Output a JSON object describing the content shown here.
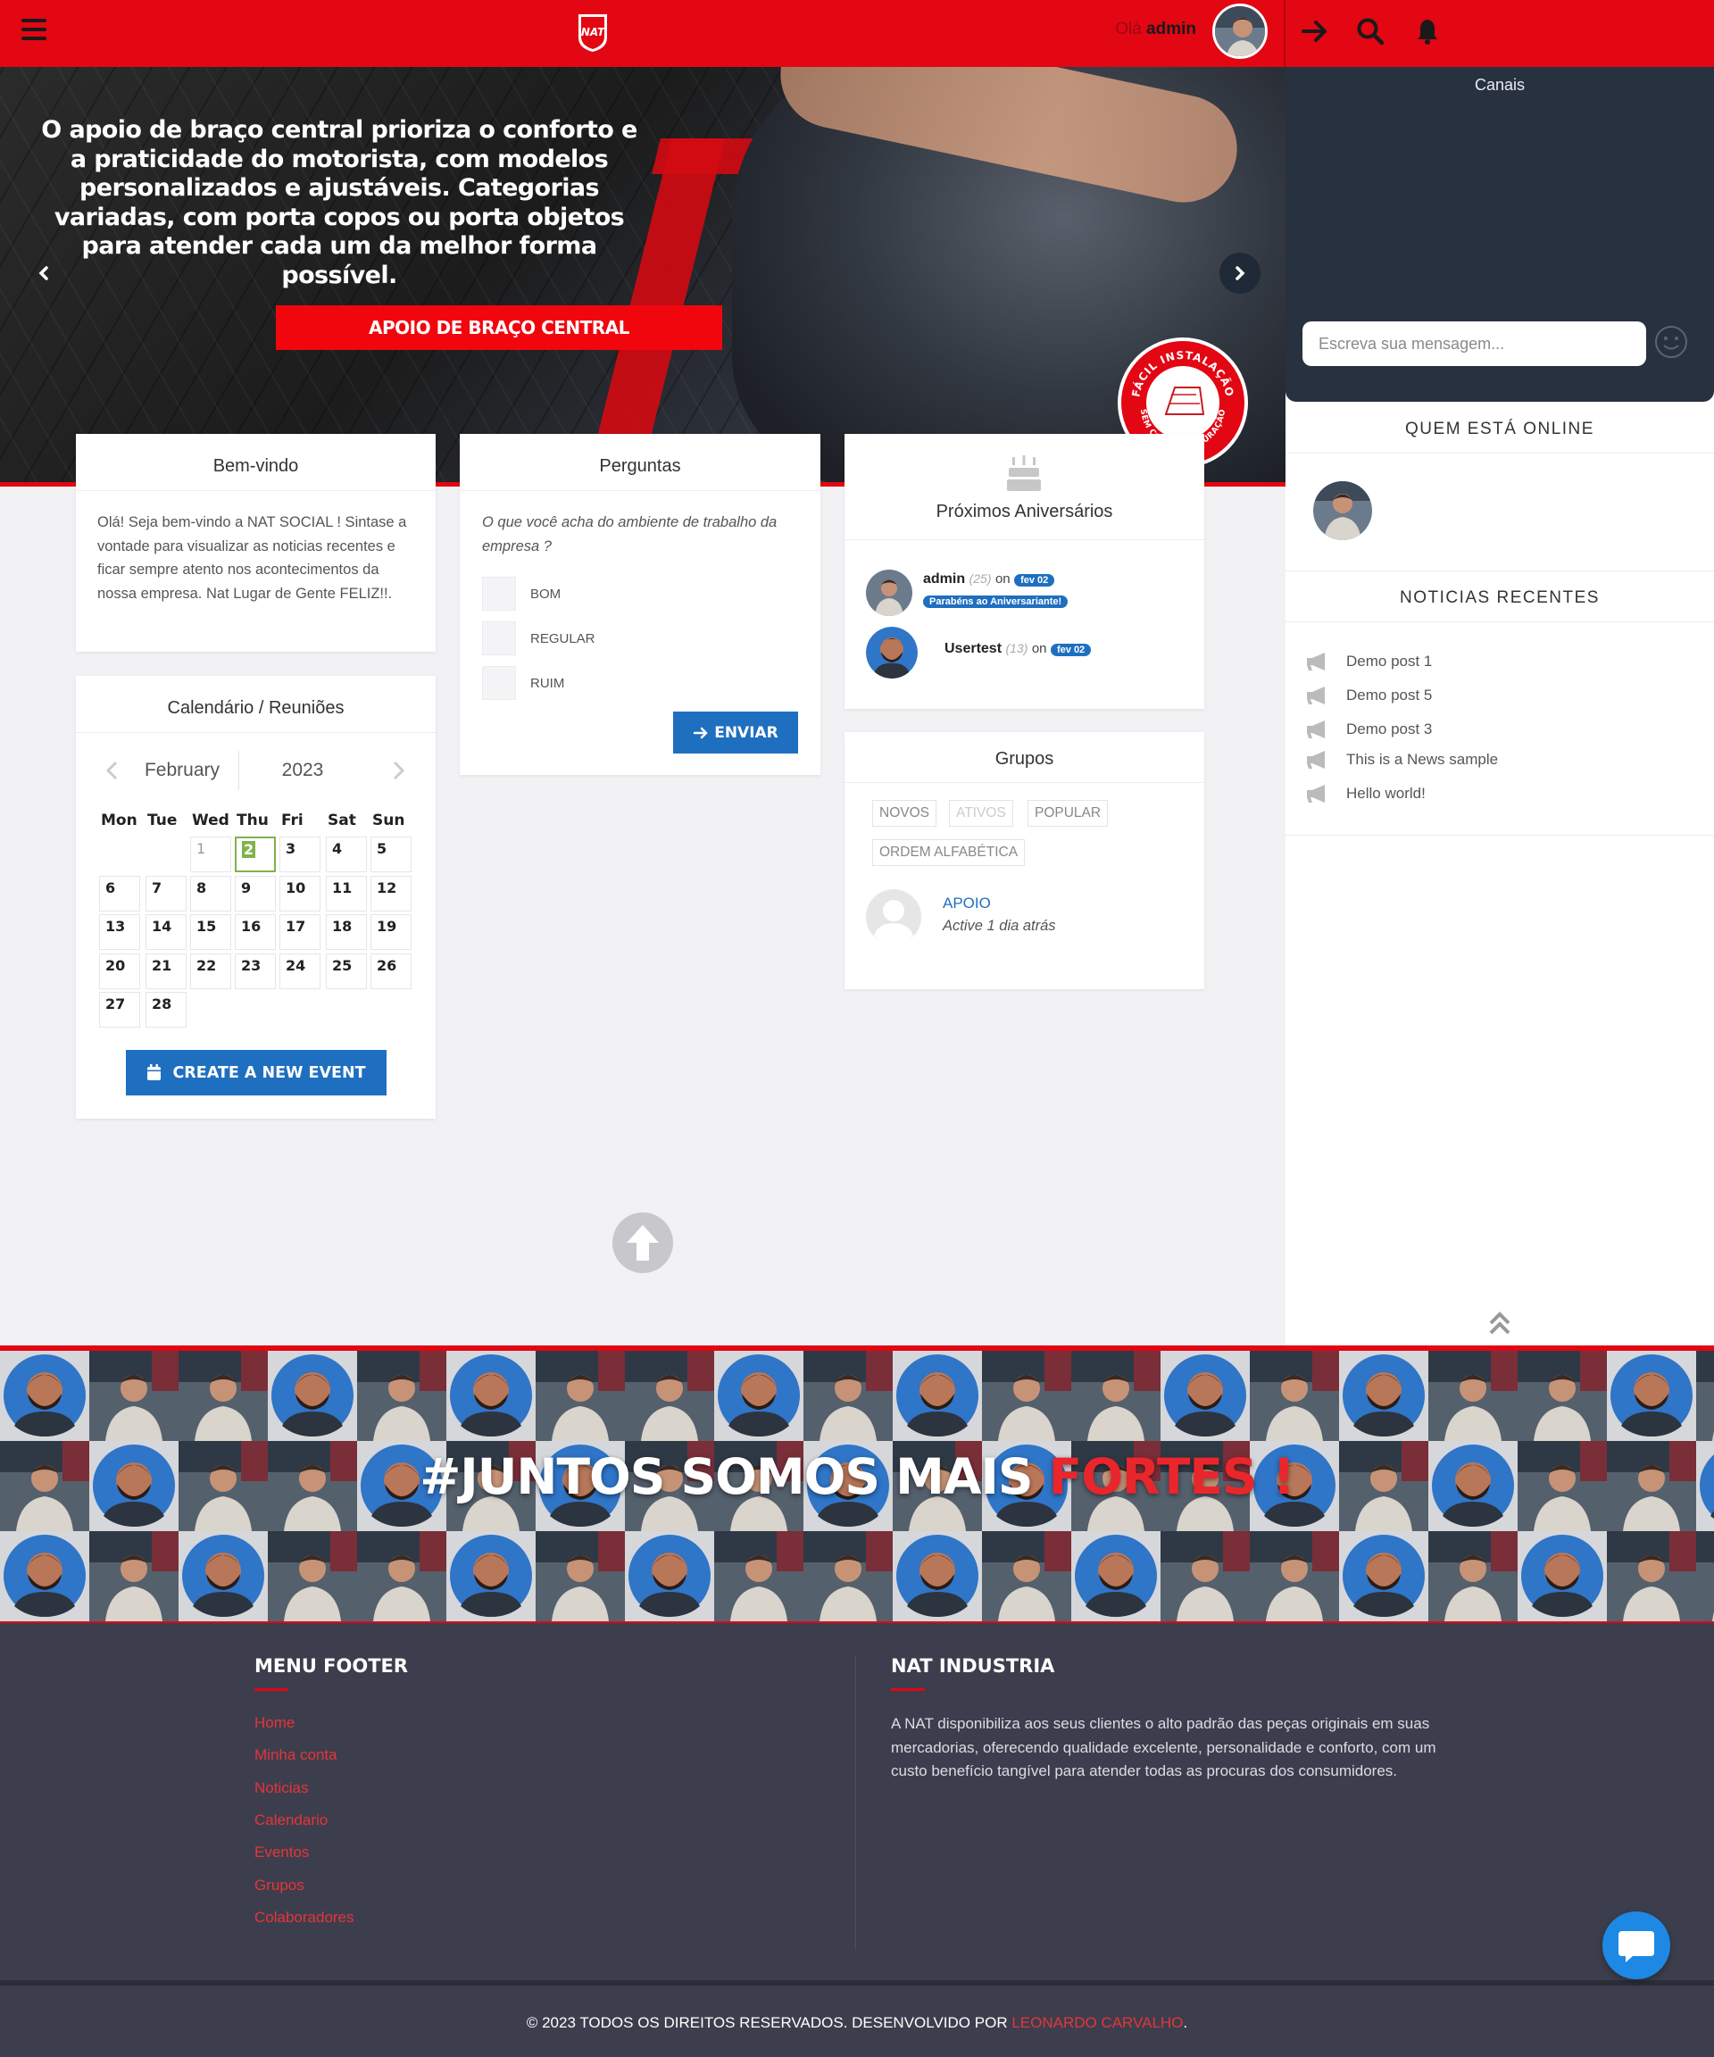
{
  "topbar": {
    "logo_text": "NAT",
    "greeting": "Olá",
    "username": "admin"
  },
  "hero": {
    "title": "O apoio de braço central prioriza o conforto e a praticidade do motorista, com modelos personalizados e ajustáveis. Categorias variadas, com porta copos ou porta objetos para atender cada um da melhor forma possível.",
    "button_label": "APOIO DE BRAÇO CENTRAL",
    "seal_top": "FÁCIL INSTALAÇÃO",
    "seal_bottom": "SEM COLA, SEM FURAÇÃO"
  },
  "welcome": {
    "title": "Bem-vindo",
    "text": "Olá! Seja bem-vindo a NAT SOCIAL ! Sintase a vontade para visualizar as noticias recentes e ficar sempre atento nos acontecimentos da nossa empresa. Nat Lugar de Gente FELIZ!!."
  },
  "calendar": {
    "title": "Calendário / Reuniões",
    "month": "February",
    "year": "2023",
    "weekdays": [
      "Mon",
      "Tue",
      "Wed",
      "Thu",
      "Fri",
      "Sat",
      "Sun"
    ],
    "cells": [
      [
        "",
        "",
        "1",
        "2",
        "3",
        "4",
        "5"
      ],
      [
        "6",
        "7",
        "8",
        "9",
        "10",
        "11",
        "12"
      ],
      [
        "13",
        "14",
        "15",
        "16",
        "17",
        "18",
        "19"
      ],
      [
        "20",
        "21",
        "22",
        "23",
        "24",
        "25",
        "26"
      ],
      [
        "27",
        "28",
        "",
        "",
        "",
        "",
        ""
      ]
    ],
    "today": "2",
    "create_label": "CREATE A NEW EVENT"
  },
  "questions": {
    "title": "Perguntas",
    "question": "O que você acha do ambiente de trabalho da empresa ?",
    "options": [
      "BOM",
      "REGULAR",
      "RUIM"
    ],
    "submit_label": "ENVIAR"
  },
  "birthdays": {
    "title": "Próximos Aniversários",
    "items": [
      {
        "name": "admin",
        "age": "(25)",
        "on": "on",
        "date": "fev 02",
        "badge": "Parabéns ao Aniversariante!"
      },
      {
        "name": "Usertest",
        "age": "(13)",
        "on": "on",
        "date": "fev 02",
        "badge": ""
      }
    ]
  },
  "groups": {
    "title": "Grupos",
    "filters": [
      "NOVOS",
      "ATIVOS",
      "POPULAR",
      "ORDEM ALFABÉTICA"
    ],
    "items": [
      {
        "name": "APOIO",
        "status": "Active 1 dia atrás"
      }
    ]
  },
  "sidebar": {
    "chat_title": "Canais",
    "chat_placeholder": "Escreva sua mensagem...",
    "online_title": "QUEM ESTÁ ONLINE",
    "news_title": "NOTICIAS RECENTES",
    "news": [
      "Demo post 1",
      "Demo post 5",
      "Demo post 3",
      "This is a News sample",
      "Hello world!"
    ]
  },
  "banner": {
    "text_white": "#JUNTOS SOMOS MAIS ",
    "text_red": "FORTES !"
  },
  "footer": {
    "menu_title": "MENU FOOTER",
    "links": [
      "Home",
      "Minha conta",
      "Noticias",
      "Calendario",
      "Eventos",
      "Grupos",
      "Colaboradores"
    ],
    "about_title": "NAT INDUSTRIA",
    "about_text": "A NAT disponibiliza aos seus clientes o alto padrão das peças originais em suas mercadorias, oferecendo qualidade excelente, personalidade e conforto, com um custo benefício tangível para atender todas as procuras dos consumidores.",
    "copyright": "© 2023 TODOS OS DIREITOS RESERVADOS. DESENVOLVIDO POR ",
    "author": "LEONARDO CARVALHO",
    "copyright_end": "."
  },
  "colors": {
    "brand_red": "#e30613",
    "accent_blue": "#1f6fc0",
    "chat_bg": "#273140",
    "footer_bg": "#3c3e4d",
    "today_green": "#7fb34a"
  },
  "icons": [
    "menu-icon",
    "nat-logo",
    "login-arrow-icon",
    "search-icon",
    "bell-icon",
    "chevron-left-icon",
    "chevron-right-icon",
    "birthday-cake-icon",
    "calendar-icon",
    "smiley-icon",
    "megaphone-icon",
    "double-chevron-up-icon",
    "arrow-up-icon",
    "chat-bubble-icon"
  ]
}
